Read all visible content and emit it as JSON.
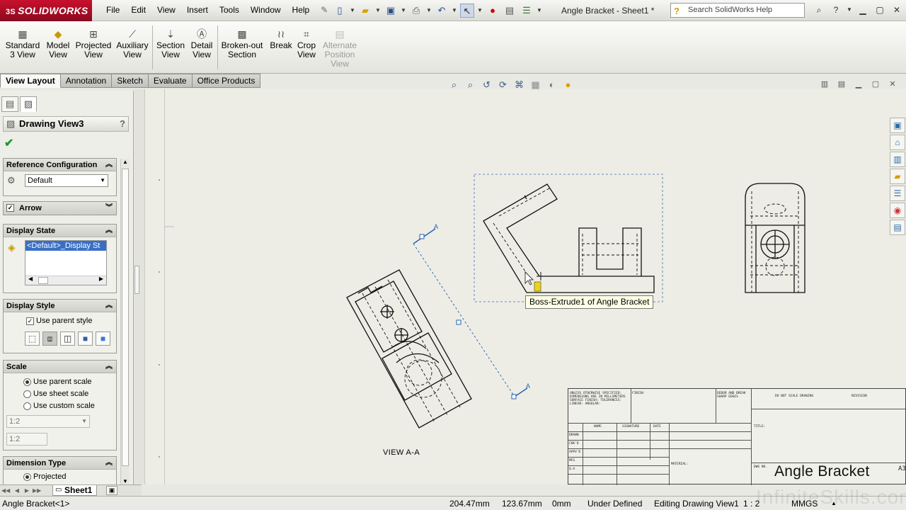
{
  "app": {
    "logo_text": "SOLIDWORKS",
    "logo_prefix": "3S",
    "document_title": "Angle Bracket - Sheet1 *",
    "search_placeholder": "Search SolidWorks Help"
  },
  "menu": [
    "File",
    "Edit",
    "View",
    "Insert",
    "Tools",
    "Window",
    "Help"
  ],
  "commands": [
    {
      "line1": "Standard",
      "line2": "3 View",
      "icon": "standard-3-view-icon"
    },
    {
      "line1": "Model",
      "line2": "View",
      "icon": "model-view-icon"
    },
    {
      "line1": "Projected",
      "line2": "View",
      "icon": "projected-view-icon"
    },
    {
      "line1": "Auxiliary",
      "line2": "View",
      "icon": "auxiliary-view-icon"
    },
    {
      "line1": "Section",
      "line2": "View",
      "icon": "section-view-icon"
    },
    {
      "line1": "Detail",
      "line2": "View",
      "icon": "detail-view-icon"
    },
    {
      "line1": "Broken-out",
      "line2": "Section",
      "icon": "broken-out-section-icon"
    },
    {
      "line1": "Break",
      "line2": "",
      "icon": "break-icon"
    },
    {
      "line1": "Crop",
      "line2": "View",
      "icon": "crop-view-icon"
    },
    {
      "line1": "Alternate",
      "line2": "Position",
      "line3": "View",
      "icon": "alternate-position-view-icon",
      "disabled": true
    }
  ],
  "tabs": [
    "View Layout",
    "Annotation",
    "Sketch",
    "Evaluate",
    "Office Products"
  ],
  "active_tab": "View Layout",
  "panel": {
    "title": "Drawing View3",
    "help": "?",
    "reference_configuration": {
      "label": "Reference Configuration",
      "value": "Default"
    },
    "arrow": {
      "label": "Arrow",
      "checked": true
    },
    "display_state": {
      "label": "Display State",
      "item": "<Default>_Display St"
    },
    "display_style": {
      "label": "Display Style",
      "use_parent": "Use parent style",
      "checked": true,
      "selected_index": 1
    },
    "scale": {
      "label": "Scale",
      "options": [
        "Use parent scale",
        "Use sheet scale",
        "Use custom scale"
      ],
      "selected": 0,
      "custom_value": "1:2",
      "custom_text": "1:2"
    },
    "dimension_type": {
      "label": "Dimension Type",
      "option": "Projected"
    }
  },
  "sheet_tab": "Sheet1",
  "drawing": {
    "tooltip": "Boss-Extrude1 of Angle Bracket",
    "section_view_label": "VIEW A-A",
    "section_letter": "A",
    "title_block_name": "Angle Bracket",
    "size_label": "A3",
    "title_block_header": "DO NOT SCALE DRAWING",
    "title_block_revision": "REVISION",
    "title_block_dwg_no": "DWG NO.",
    "title_block_rows": [
      "DRAWN",
      "CHK'D",
      "APPV'D",
      "MFG",
      "Q.A"
    ],
    "title_block_cols": [
      "NAME",
      "SIGNATURE",
      "DATE"
    ],
    "title_block_notes": "UNLESS OTHERWISE SPECIFIED: DIMENSIONS ARE IN MILLIMETERS SURFACE FINISH: TOLERANCES: LINEAR: ANGULAR:",
    "title_block_finish": "FINISH",
    "title_block_debur": "DEBUR AND BREAK SHARP EDGES",
    "title_block_material": "MATERIAL:",
    "title_block_title_label": "TITLE:"
  },
  "status": {
    "part": "Angle Bracket<1>",
    "x": "204.47mm",
    "y": "123.67mm",
    "z": "0mm",
    "state": "Under Defined",
    "mode": "Editing Drawing View1",
    "scale": "1 : 2",
    "units": "MMGS"
  },
  "watermark": "InfiniteSkills.com"
}
